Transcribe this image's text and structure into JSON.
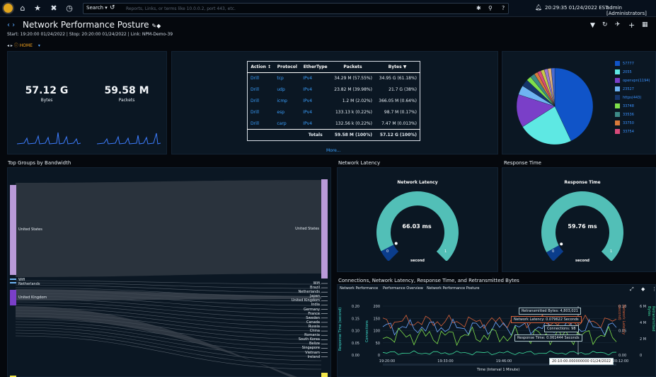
{
  "topbar": {
    "search_label": "Search",
    "search_placeholder": "Reports, Links, or terms like 10.0.0.2, port 443, etc.",
    "clock": "20:29:35 01/24/2022 EST",
    "user": "admin [Administrators]"
  },
  "page": {
    "title": "Network Performance Posture",
    "subtitle": "Start: 19:20:00 01/24/2022 | Stop: 20:20:00 01/24/2022 | Link: NPM-Demo-39",
    "crumb_home": "HOME"
  },
  "summary": {
    "bytes_value": "57.12 G",
    "bytes_label": "Bytes",
    "packets_value": "59.58 M",
    "packets_label": "Packets"
  },
  "protocol_table": {
    "headers": [
      "Action",
      "Protocol",
      "EtherType",
      "Packets",
      "Bytes"
    ],
    "rows": [
      [
        "Drill",
        "tcp",
        "IPv4",
        "34.29 M (57.55%)",
        "34.95 G (61.18%)"
      ],
      [
        "Drill",
        "udp",
        "IPv4",
        "23.82 M (39.98%)",
        "21.7 G (38%)"
      ],
      [
        "Drill",
        "icmp",
        "IPv4",
        "1.2 M (2.02%)",
        "366.05 M (0.64%)"
      ],
      [
        "Drill",
        "esp",
        "IPv4",
        "133.13 k (0.22%)",
        "98.7 M (0.17%)"
      ],
      [
        "Drill",
        "carp",
        "IPv4",
        "132.56 k (0.22%)",
        "7.47 M (0.013%)"
      ]
    ],
    "total_label": "Totals",
    "total_packets": "59.58 M (100%)",
    "total_bytes": "57.12 G (100%)",
    "more": "More..."
  },
  "pie": {
    "legend": [
      {
        "label": "57777",
        "color": "#1054c8"
      },
      {
        "label": "2055",
        "color": "#5ee8e3"
      },
      {
        "label": "openvpn(1194)",
        "color": "#7a3fc8"
      },
      {
        "label": "23527",
        "color": "#6fb4f2"
      },
      {
        "label": "https(443)",
        "color": "#15346b"
      },
      {
        "label": "33748",
        "color": "#7fe04a"
      },
      {
        "label": "33536",
        "color": "#3d8a87"
      },
      {
        "label": "33750",
        "color": "#d97a3a"
      },
      {
        "label": "33754",
        "color": "#d84a7a"
      }
    ],
    "slices": [
      {
        "color": "#1054c8",
        "pct": 43
      },
      {
        "color": "#5ee8e3",
        "pct": 23
      },
      {
        "color": "#7a3fc8",
        "pct": 14
      },
      {
        "color": "#6fb4f2",
        "pct": 4
      },
      {
        "color": "#15346b",
        "pct": 3
      },
      {
        "color": "#7fe04a",
        "pct": 2
      },
      {
        "color": "#3d8a87",
        "pct": 2
      },
      {
        "color": "#d97a3a",
        "pct": 1.5
      },
      {
        "color": "#d84a7a",
        "pct": 1.5
      },
      {
        "color": "#c9c94a",
        "pct": 1.5
      },
      {
        "color": "#9a7ad0",
        "pct": 1.5
      },
      {
        "color": "#e0b07a",
        "pct": 1.5
      },
      {
        "color": "#4a6ad0",
        "pct": 1.5
      }
    ]
  },
  "sankey": {
    "title": "Top Groups by Bandwidth",
    "left": [
      "United States",
      "Wifi",
      "Netherlands",
      "United Kingdom"
    ],
    "right": [
      "United States",
      "Wifi",
      "Brazil",
      "Netherlands",
      "Japan",
      "United Kingdom",
      "India",
      "Germany",
      "France",
      "Sweden",
      "Canada",
      "Russia",
      "China",
      "Romania",
      "South Korea",
      "Belize",
      "Singapore",
      "Vietnam",
      "Ireland"
    ]
  },
  "latency": {
    "panel_title": "Network Latency",
    "gauge_title": "Network Latency",
    "value": "66.03 ms",
    "min": "0",
    "max": "1",
    "unit": "second",
    "level": 0.066
  },
  "response": {
    "panel_title": "Response Time",
    "gauge_title": "Response Time",
    "value": "59.76 ms",
    "min": "0",
    "max": "1",
    "unit": "second",
    "level": 0.06
  },
  "timeseries": {
    "title": "Connections, Network Latency, Response Time, and Retransmitted Bytes",
    "tabs": [
      "Network Performance",
      "Performance Overview",
      "Network Performance Posture"
    ],
    "y_left_label": "Response Time (second)",
    "y_conn_label": "Connections",
    "y_right_label": "Network Latency (second)",
    "y_right2_label": "Retransmitted Bytes",
    "y_left_ticks": [
      "0.20",
      "0.15",
      "0.10",
      "0.05",
      "0.00"
    ],
    "y_conn_ticks": [
      "200",
      "150",
      "100",
      "50",
      "0"
    ],
    "y_right_ticks": [
      "0.10",
      "0.05",
      "0.00"
    ],
    "y_right2_ticks": [
      "6 M",
      "4 M",
      "2 M",
      "0"
    ],
    "x_ticks": [
      "19:20:00",
      "19:33:00",
      "19:46:00",
      "19:59:00",
      "20:12:00"
    ],
    "xlabel": "Time (Interval 1 Minute)",
    "tooltips": {
      "retrans": "Retransmitted Bytes: 4,803,021",
      "latency": "Network Latency: 0.079622 Seconds",
      "connections": "Connections: 98",
      "response": "Response Time: 0.061444 Seconds",
      "time": "20:10:00.000000000 01/24/2022"
    }
  }
}
